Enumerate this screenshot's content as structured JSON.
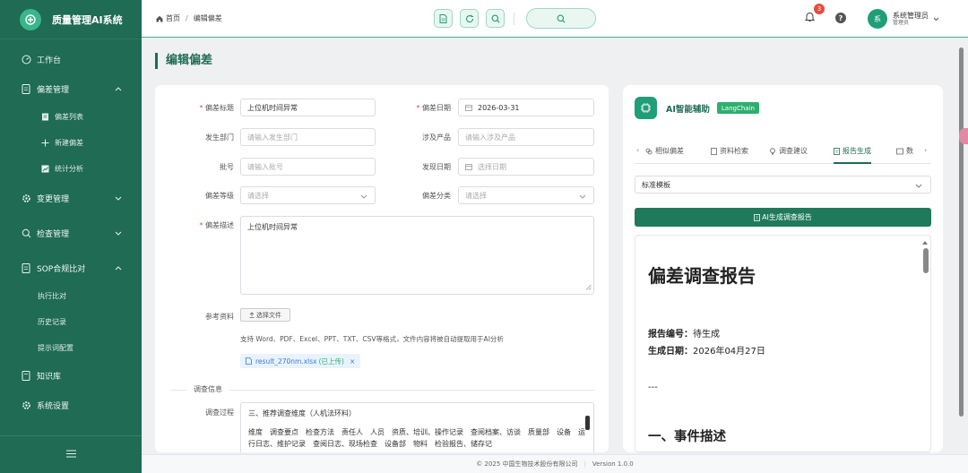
{
  "brand": {
    "title": "质量管理AI系统"
  },
  "sidebar": {
    "items": [
      {
        "label": "工作台"
      },
      {
        "label": "偏差管理"
      },
      {
        "label": "偏差列表"
      },
      {
        "label": "新建偏差"
      },
      {
        "label": "统计分析"
      },
      {
        "label": "变更管理"
      },
      {
        "label": "检查管理"
      },
      {
        "label": "SOP合规比对"
      },
      {
        "label": "执行比对"
      },
      {
        "label": "历史记录"
      },
      {
        "label": "提示词配置"
      },
      {
        "label": "知识库"
      },
      {
        "label": "系统设置"
      }
    ]
  },
  "topbar": {
    "breadcrumb": [
      "首页",
      "编辑偏差"
    ],
    "notification_count": "3",
    "user_name": "系统管理员",
    "user_role": "管理员",
    "avatar_text": "系"
  },
  "page": {
    "title": "编辑偏差"
  },
  "form": {
    "title_label": "偏差标题",
    "title_value": "上位机时间异常",
    "date_label": "偏差日期",
    "date_value": "2026-03-31",
    "dept_label": "发生部门",
    "dept_placeholder": "请输入发生部门",
    "product_label": "涉及产品",
    "product_placeholder": "请输入涉及产品",
    "batch_label": "批号",
    "batch_placeholder": "请输入批号",
    "found_date_label": "发现日期",
    "found_date_placeholder": "选择日期",
    "level_label": "偏差等级",
    "level_placeholder": "请选择",
    "category_label": "偏差分类",
    "category_placeholder": "请选择",
    "desc_label": "偏差描述",
    "desc_value": "上位机时间异常",
    "ref_label": "参考资料",
    "upload_label": "选择文件",
    "upload_hint": "支持 Word、PDF、Excel、PPT、TXT、CSV等格式，文件内容将被自动提取用于AI分析",
    "file_name": "result_270nm.xlsx",
    "file_status": "(已上传)",
    "section_label": "调查信息",
    "process_label": "调查过程",
    "process_line1": "三、推荐调查维度（人机法环料）",
    "process_line2": "维度　调查要点　检查方法　责任人　人员　资质、培训、操作记录　查阅档案、访谈　质量部　设备　运行日志、维护记录　查阅日志、现场检查　设备部　物料　检验报告、储存记"
  },
  "ai": {
    "title": "AI智能辅助",
    "tag": "LangChain",
    "tabs": [
      "相似偏差",
      "资料检索",
      "调查建议",
      "报告生成",
      "数"
    ],
    "active_tab": "报告生成",
    "template": "标准模板",
    "generate_label": "AI生成调查报告",
    "report": {
      "title": "偏差调查报告",
      "no_label": "报告编号：",
      "no_value": "待生成",
      "date_label": "生成日期：",
      "date_value": "2026年04月27日",
      "hr": "---",
      "section1": "一、事件描述"
    }
  },
  "footer": {
    "copyright": "© 2025 中国生物技术股份有限公司",
    "version": "Version 1.0.0"
  },
  "colors": {
    "primary": "#1f6b54",
    "accent": "#2eaf6e",
    "danger": "#e74c3c"
  }
}
